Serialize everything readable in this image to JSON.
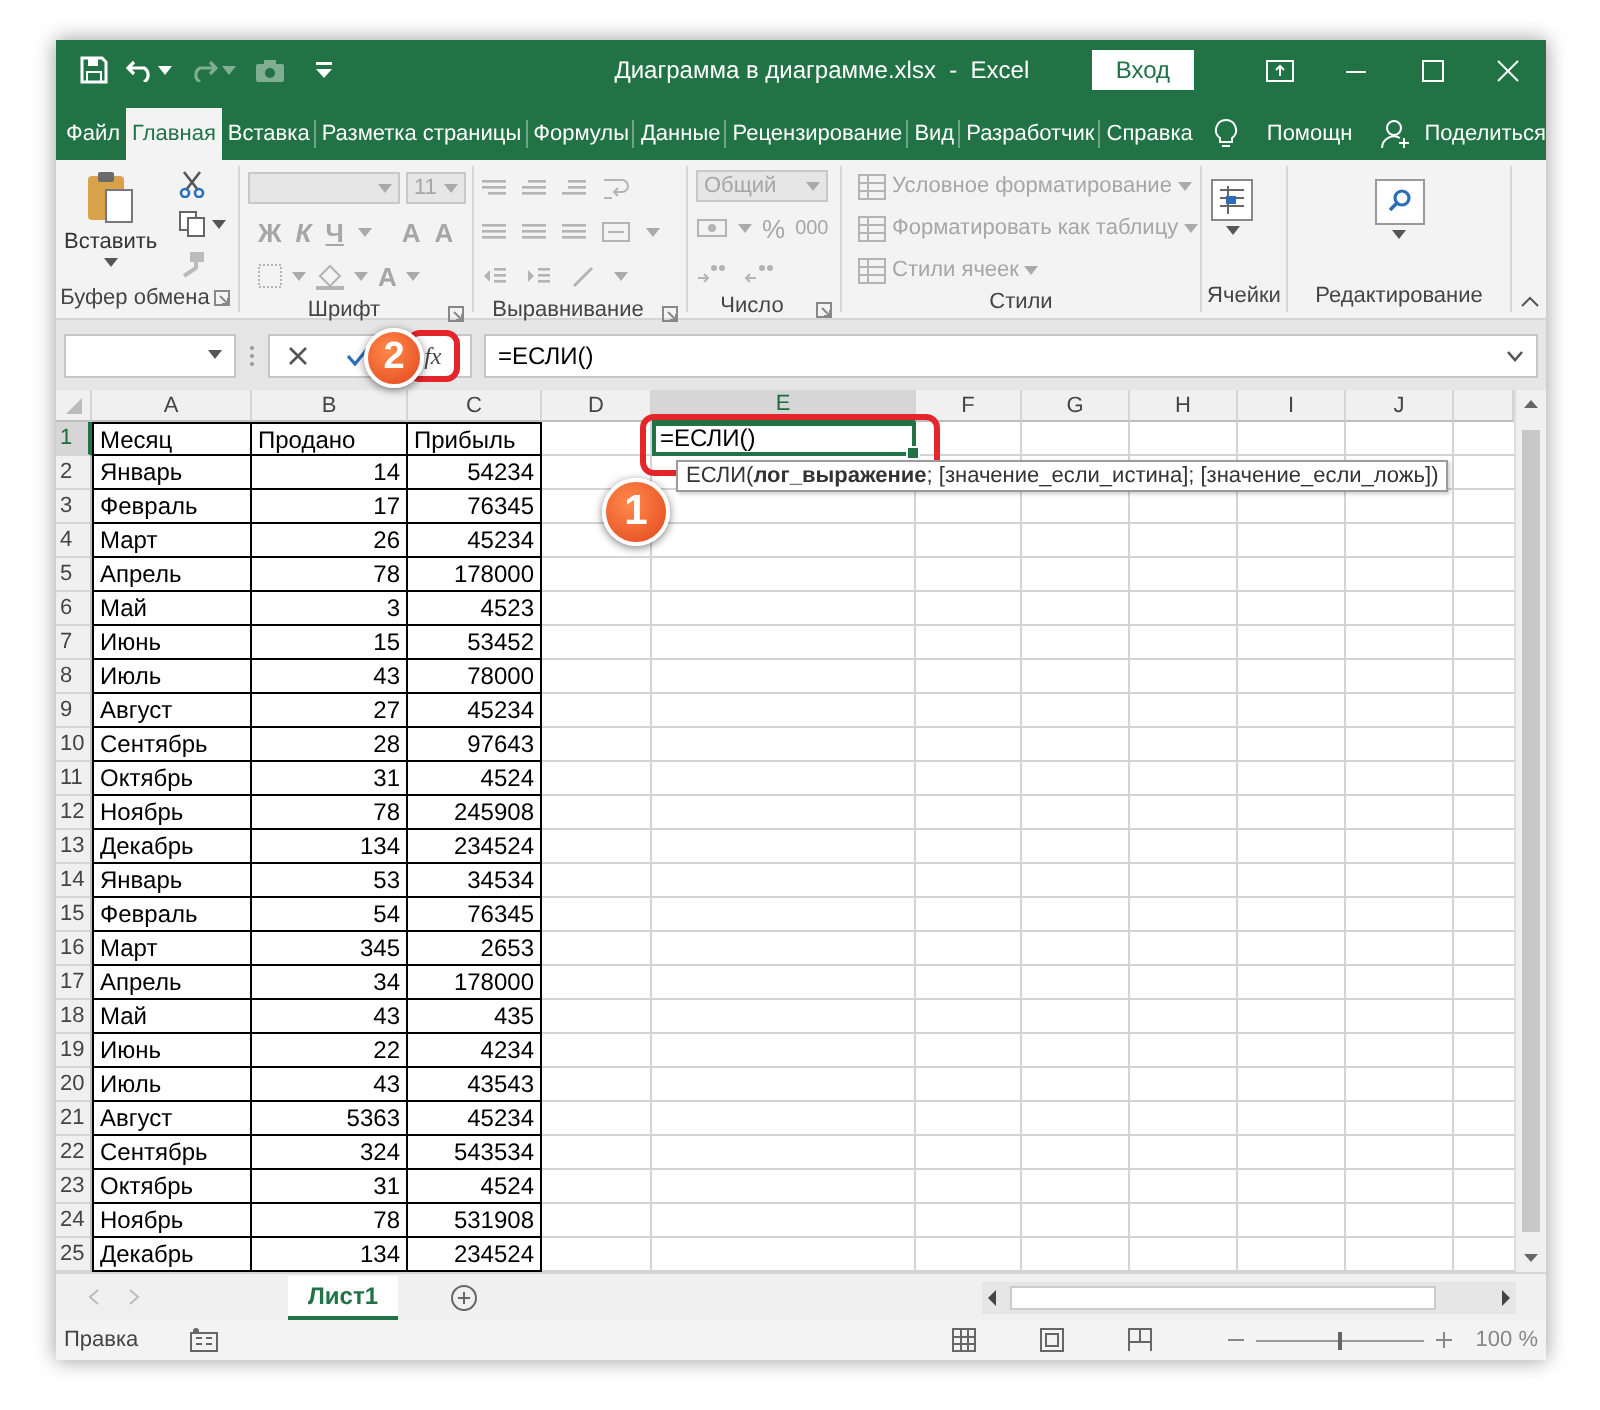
{
  "window": {
    "title": "Диаграмма в диаграмме.xlsx  -  Excel",
    "sign_in": "Вход"
  },
  "quick_access": [
    {
      "kind": "save",
      "disabled": false
    },
    {
      "kind": "undo",
      "disabled": false
    },
    {
      "kind": "redo",
      "disabled": true
    },
    {
      "kind": "camera",
      "disabled": true
    },
    {
      "kind": "customize",
      "disabled": false
    }
  ],
  "tabs": [
    {
      "label": "Файл",
      "selected": false
    },
    {
      "label": "Главная",
      "selected": true
    },
    {
      "label": "Вставка",
      "selected": false
    },
    {
      "label": "Разметка страницы",
      "selected": false
    },
    {
      "label": "Формулы",
      "selected": false
    },
    {
      "label": "Данные",
      "selected": false
    },
    {
      "label": "Рецензирование",
      "selected": false
    },
    {
      "label": "Вид",
      "selected": false
    },
    {
      "label": "Разработчик",
      "selected": false
    },
    {
      "label": "Справка",
      "selected": false
    }
  ],
  "help": "Помощн",
  "share": "Поделиться",
  "ribbon": {
    "clipboard": {
      "label": "Буфер обмена",
      "paste": "Вставить",
      "disabled": false
    },
    "font": {
      "label": "Шрифт",
      "size": "11",
      "bold": "Ж",
      "italic": "К",
      "underline": "Ч",
      "grow": "A",
      "shrink": "A",
      "text_color_button": "A",
      "disabled": true
    },
    "alignment": {
      "label": "Выравнивание",
      "disabled": true
    },
    "number": {
      "label": "Число",
      "format": "Общий",
      "percent": "%",
      "thousands": "000",
      "disabled": true
    },
    "styles": {
      "label": "Стили",
      "items": [
        "Условное форматирование",
        "Форматировать как таблицу",
        "Стили ячеек"
      ],
      "disabled": true
    },
    "cells": {
      "label": "Ячейки",
      "disabled": false
    },
    "editing": {
      "label": "Редактирование",
      "disabled": false
    }
  },
  "formula_bar": {
    "function_button": "fx",
    "formula": "=ЕСЛИ()",
    "callout": "2"
  },
  "sheet": {
    "columns": [
      {
        "label": "A",
        "selected": false
      },
      {
        "label": "B",
        "selected": false
      },
      {
        "label": "C",
        "selected": false
      },
      {
        "label": "D",
        "selected": false
      },
      {
        "label": "E",
        "selected": true
      },
      {
        "label": "F",
        "selected": false
      },
      {
        "label": "G",
        "selected": false
      },
      {
        "label": "H",
        "selected": false
      },
      {
        "label": "I",
        "selected": false
      },
      {
        "label": "J",
        "selected": false
      }
    ],
    "rows": [
      {
        "number": "1",
        "selected": true,
        "kind": "header",
        "cells": [
          "Месяц",
          "Продано",
          "Прибыль"
        ]
      },
      {
        "number": "2",
        "selected": false,
        "kind": "data",
        "cells": [
          "Январь",
          "14",
          "54234"
        ]
      },
      {
        "number": "3",
        "selected": false,
        "kind": "data",
        "cells": [
          "Февраль",
          "17",
          "76345"
        ]
      },
      {
        "number": "4",
        "selected": false,
        "kind": "data",
        "cells": [
          "Март",
          "26",
          "45234"
        ]
      },
      {
        "number": "5",
        "selected": false,
        "kind": "data",
        "cells": [
          "Апрель",
          "78",
          "178000"
        ]
      },
      {
        "number": "6",
        "selected": false,
        "kind": "data",
        "cells": [
          "Май",
          "3",
          "4523"
        ]
      },
      {
        "number": "7",
        "selected": false,
        "kind": "data",
        "cells": [
          "Июнь",
          "15",
          "53452"
        ]
      },
      {
        "number": "8",
        "selected": false,
        "kind": "data",
        "cells": [
          "Июль",
          "43",
          "78000"
        ]
      },
      {
        "number": "9",
        "selected": false,
        "kind": "data",
        "cells": [
          "Август",
          "27",
          "45234"
        ]
      },
      {
        "number": "10",
        "selected": false,
        "kind": "data",
        "cells": [
          "Сентябрь",
          "28",
          "97643"
        ]
      },
      {
        "number": "11",
        "selected": false,
        "kind": "data",
        "cells": [
          "Октябрь",
          "31",
          "4524"
        ]
      },
      {
        "number": "12",
        "selected": false,
        "kind": "data",
        "cells": [
          "Ноябрь",
          "78",
          "245908"
        ]
      },
      {
        "number": "13",
        "selected": false,
        "kind": "data",
        "cells": [
          "Декабрь",
          "134",
          "234524"
        ]
      },
      {
        "number": "14",
        "selected": false,
        "kind": "data",
        "cells": [
          "Январь",
          "53",
          "34534"
        ]
      },
      {
        "number": "15",
        "selected": false,
        "kind": "data",
        "cells": [
          "Февраль",
          "54",
          "76345"
        ]
      },
      {
        "number": "16",
        "selected": false,
        "kind": "data",
        "cells": [
          "Март",
          "345",
          "2653"
        ]
      },
      {
        "number": "17",
        "selected": false,
        "kind": "data",
        "cells": [
          "Апрель",
          "34",
          "178000"
        ]
      },
      {
        "number": "18",
        "selected": false,
        "kind": "data",
        "cells": [
          "Май",
          "43",
          "435"
        ]
      },
      {
        "number": "19",
        "selected": false,
        "kind": "data",
        "cells": [
          "Июнь",
          "22",
          "4234"
        ]
      },
      {
        "number": "20",
        "selected": false,
        "kind": "data",
        "cells": [
          "Июль",
          "43",
          "43543"
        ]
      },
      {
        "number": "21",
        "selected": false,
        "kind": "data",
        "cells": [
          "Август",
          "5363",
          "45234"
        ]
      },
      {
        "number": "22",
        "selected": false,
        "kind": "data",
        "cells": [
          "Сентябрь",
          "324",
          "543534"
        ]
      },
      {
        "number": "23",
        "selected": false,
        "kind": "data",
        "cells": [
          "Октябрь",
          "31",
          "4524"
        ]
      },
      {
        "number": "24",
        "selected": false,
        "kind": "data",
        "cells": [
          "Ноябрь",
          "78",
          "531908"
        ]
      },
      {
        "number": "25",
        "selected": false,
        "kind": "data",
        "cells": [
          "Декабрь",
          "134",
          "234524"
        ]
      }
    ],
    "editing_cell": {
      "value": "=ЕСЛИ()",
      "tooltip": "ЕСЛИ(**лог_выражение**; [значение_если_истина]; [значение_если_ложь])",
      "callout": "1"
    }
  },
  "sheet_tabs": [
    {
      "label": "Лист1",
      "selected": true
    }
  ],
  "status_bar": {
    "mode": "Правка",
    "zoom": {
      "level": 0.5,
      "reading": "100 %"
    }
  }
}
